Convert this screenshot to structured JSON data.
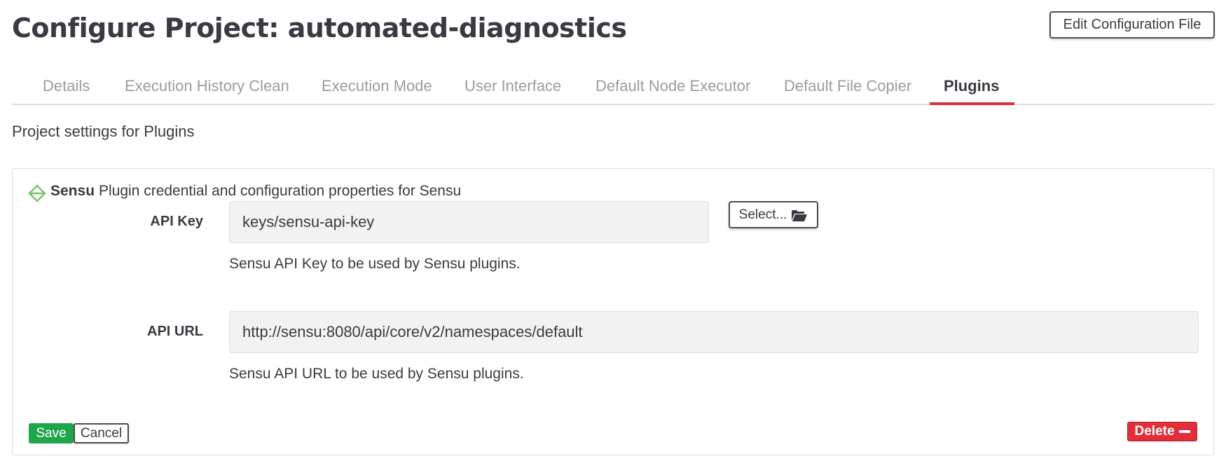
{
  "header": {
    "title": "Configure Project: automated-diagnostics",
    "edit_config_label": "Edit Configuration File"
  },
  "tabs": [
    {
      "label": "Details"
    },
    {
      "label": "Execution History Clean"
    },
    {
      "label": "Execution Mode"
    },
    {
      "label": "User Interface"
    },
    {
      "label": "Default Node Executor"
    },
    {
      "label": "Default File Copier"
    },
    {
      "label": "Plugins",
      "active": true
    }
  ],
  "section": {
    "description": "Project settings for Plugins"
  },
  "plugin": {
    "name": "Sensu",
    "description": "Plugin credential and configuration properties for Sensu",
    "icon": "sensu-logo-icon",
    "fields": [
      {
        "label": "API Key",
        "value": "keys/sensu-api-key",
        "help": "Sensu API Key to be used by Sensu plugins.",
        "select_label": "Select..."
      },
      {
        "label": "API URL",
        "value": "http://sensu:8080/api/core/v2/namespaces/default",
        "help": "Sensu API URL to be used by Sensu plugins."
      }
    ]
  },
  "actions": {
    "save_label": "Save",
    "cancel_label": "Cancel",
    "delete_label": "Delete"
  },
  "colors": {
    "accent_tab_underline": "#e0303a",
    "save_green": "#1ea64b",
    "delete_red": "#e12f3a",
    "sensu_green": "#7bc26e"
  }
}
